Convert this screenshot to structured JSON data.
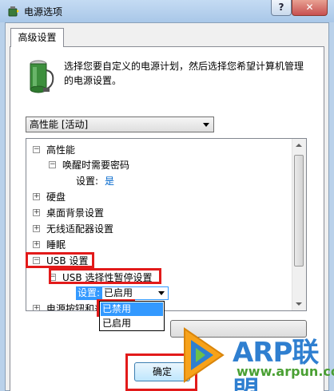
{
  "window": {
    "title": "电源选项",
    "help_label": "?",
    "close_label": "✕"
  },
  "tab": {
    "label": "高级设置"
  },
  "description": "选择您要自定义的电源计划，然后选择您希望计算机管理的电源设置。",
  "plan_select": {
    "value": "高性能 [活动]"
  },
  "tree": {
    "items": [
      {
        "label": "高性能",
        "expander": "−"
      },
      {
        "label": "唤醒时需要密码",
        "expander": "−"
      },
      {
        "label": "设置:",
        "value": "是"
      },
      {
        "label": "硬盘",
        "expander": "+"
      },
      {
        "label": "桌面背景设置",
        "expander": "+"
      },
      {
        "label": "无线适配器设置",
        "expander": "+"
      },
      {
        "label": "睡眠",
        "expander": "+"
      },
      {
        "label": "USB 设置",
        "expander": "−"
      },
      {
        "label": "USB 选择性暂停设置",
        "expander": "−"
      },
      {
        "label": "设置:"
      },
      {
        "label": "电源按钮和盖",
        "expander": "+"
      }
    ]
  },
  "setting_combo": {
    "value": "已启用",
    "options": [
      "已禁用",
      "已启用"
    ]
  },
  "ok_label": "确定",
  "watermark": {
    "brand": "ARP联盟",
    "url": "www.arpun.com"
  },
  "colors": {
    "highlight": "#e21a1a",
    "selection": "#3399ff",
    "value_blue": "#0066cc"
  }
}
